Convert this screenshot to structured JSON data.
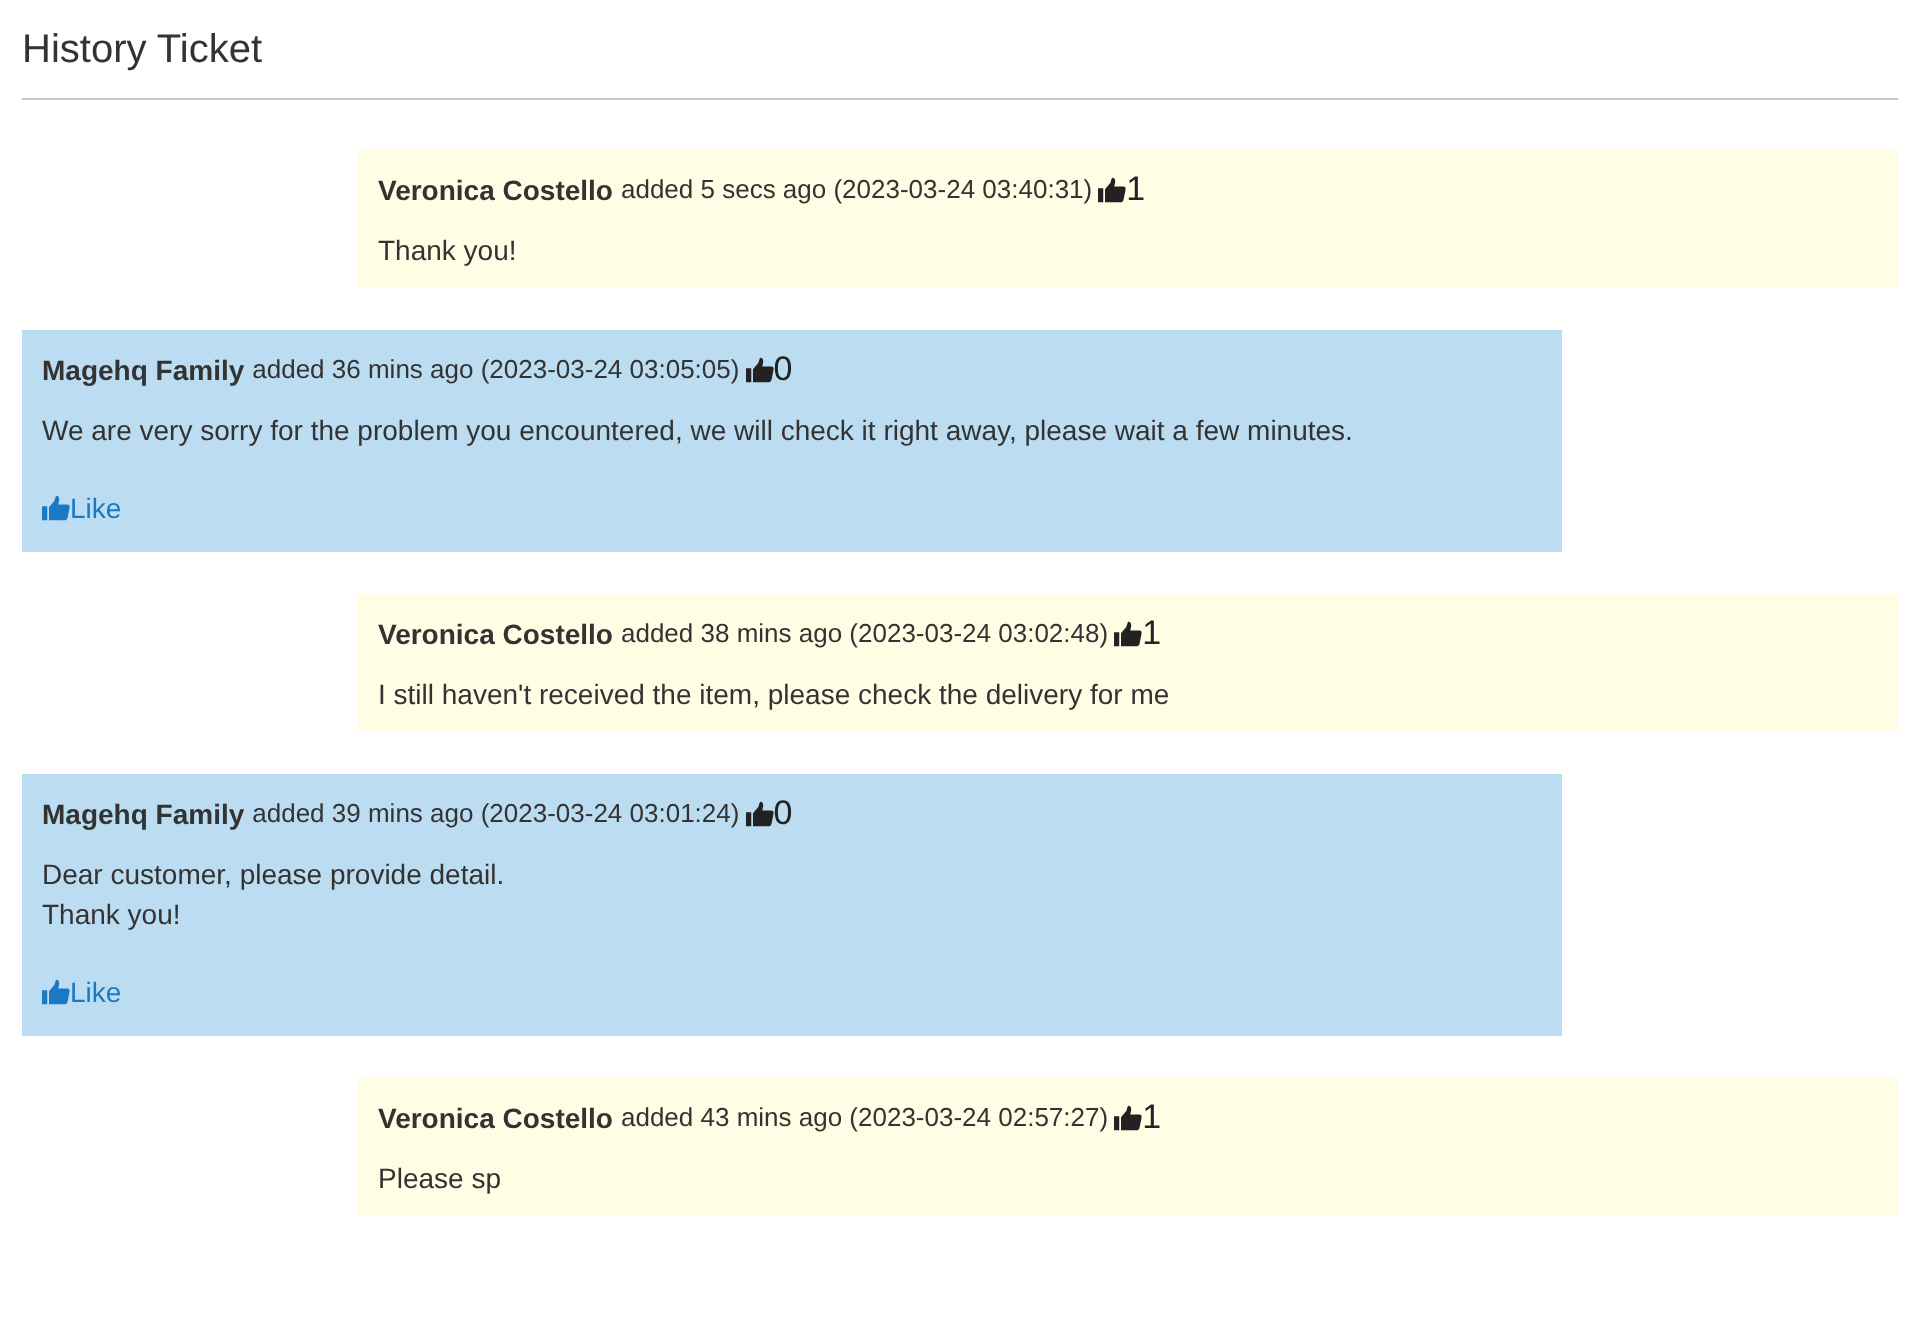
{
  "title": "History Ticket",
  "messages": [
    {
      "kind": "customer",
      "author": "Veronica Costello",
      "meta": "added 5 secs ago (2023-03-24 03:40:31)",
      "likes": "1",
      "lines": [
        "Thank you!"
      ]
    },
    {
      "kind": "staff",
      "author": "Magehq Family",
      "meta": "added 36 mins ago (2023-03-24 03:05:05)",
      "likes": "0",
      "lines": [
        "We are very sorry for the problem you encountered, we will check it right away, please wait a few minutes."
      ],
      "like_link": "Like"
    },
    {
      "kind": "customer",
      "author": "Veronica Costello",
      "meta": "added 38 mins ago (2023-03-24 03:02:48)",
      "likes": "1",
      "lines": [
        "I still haven't received the item, please check the delivery for me"
      ]
    },
    {
      "kind": "staff",
      "author": "Magehq Family",
      "meta": "added 39 mins ago (2023-03-24 03:01:24)",
      "likes": "0",
      "lines": [
        "Dear customer, please provide detail.",
        "Thank you!"
      ],
      "like_link": "Like"
    },
    {
      "kind": "customer",
      "author": "Veronica Costello",
      "meta": "added 43 mins ago (2023-03-24 02:57:27)",
      "likes": "1",
      "lines": [
        "Please sp"
      ]
    }
  ]
}
